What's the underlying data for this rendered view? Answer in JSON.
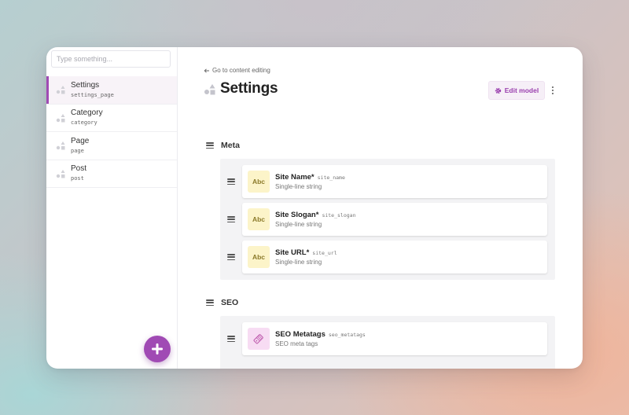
{
  "sidebar": {
    "search_placeholder": "Type something...",
    "items": [
      {
        "label": "Settings",
        "key": "settings_page",
        "active": true
      },
      {
        "label": "Category",
        "key": "category",
        "active": false
      },
      {
        "label": "Page",
        "key": "page",
        "active": false
      },
      {
        "label": "Post",
        "key": "post",
        "active": false
      }
    ],
    "add_icon": "plus-icon"
  },
  "main": {
    "back_link": "Go to content editing",
    "title": "Settings",
    "edit_model_label": "Edit model",
    "groups": [
      {
        "title": "Meta",
        "fields": [
          {
            "name": "Site Name*",
            "key": "site_name",
            "type": "Single-line string",
            "icon_text": "Abc"
          },
          {
            "name": "Site Slogan*",
            "key": "site_slogan",
            "type": "Single-line string",
            "icon_text": "Abc"
          },
          {
            "name": "Site URL*",
            "key": "site_url",
            "type": "Single-line string",
            "icon_text": "Abc"
          }
        ]
      },
      {
        "title": "SEO",
        "fields": [
          {
            "name": "SEO Metatags",
            "key": "seo_metatags",
            "type": "SEO meta tags",
            "icon": "tag-icon"
          }
        ]
      }
    ]
  },
  "colors": {
    "accent": "#a04ab4",
    "accent_light": "#f6eff7",
    "string_icon_bg": "#fcf4c9",
    "seo_icon_bg": "#f7dcf3"
  }
}
